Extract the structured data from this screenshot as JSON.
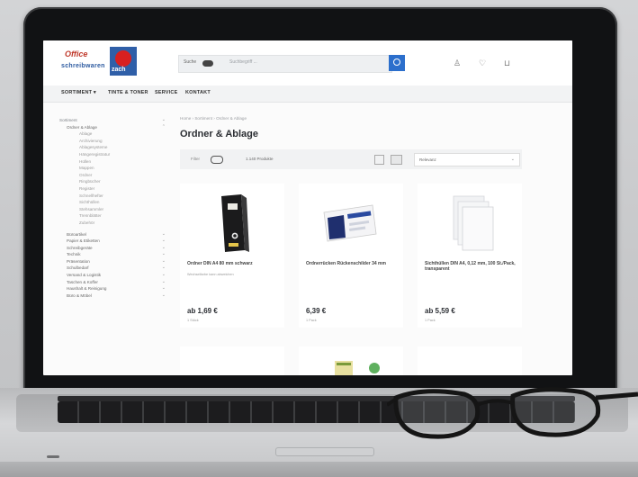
{
  "site": {
    "logo_left_line1": "Office",
    "logo_left_line2": "schreibwaren",
    "logo_brand": "zach"
  },
  "search": {
    "toggle_label": "Suche",
    "placeholder": "Suchbegriff ..."
  },
  "nav": {
    "items": [
      "SORTIMENT ▾",
      "TINTE & TONER",
      "SERVICE",
      "KONTAKT"
    ]
  },
  "sidebar": {
    "items": [
      {
        "label": "Sortiment",
        "level": 0
      },
      {
        "label": "Ordner & Ablage",
        "level": 1
      },
      {
        "label": "Ablage",
        "level": 2
      },
      {
        "label": "Archivierung",
        "level": 2
      },
      {
        "label": "Ablagesysteme",
        "level": 2
      },
      {
        "label": "Hängeregistratur",
        "level": 2
      },
      {
        "label": "Hüllen",
        "level": 2
      },
      {
        "label": "Mappen",
        "level": 2
      },
      {
        "label": "Ordner",
        "level": 2
      },
      {
        "label": "Ringbücher",
        "level": 2
      },
      {
        "label": "Register",
        "level": 2
      },
      {
        "label": "Schnellhefter",
        "level": 2
      },
      {
        "label": "Sichthüllen",
        "level": 2
      },
      {
        "label": "Stehsammler",
        "level": 2
      },
      {
        "label": "Trennblätter",
        "level": 2
      },
      {
        "label": "Zubehör",
        "level": 2
      },
      {
        "label": "Büroartikel",
        "level": 1
      },
      {
        "label": "Papier & Etiketten",
        "level": 1
      },
      {
        "label": "Schreibgeräte",
        "level": 1
      },
      {
        "label": "Technik",
        "level": 1
      },
      {
        "label": "Präsentation",
        "level": 1
      },
      {
        "label": "Schulbedarf",
        "level": 1
      },
      {
        "label": "Versand & Logistik",
        "level": 1
      },
      {
        "label": "Taschen & Koffer",
        "level": 1
      },
      {
        "label": "Haushalt & Reinigung",
        "level": 1
      },
      {
        "label": "Büro & Möbel",
        "level": 1
      }
    ]
  },
  "breadcrumb": "Home › Sortiment › Ordner & Ablage",
  "page_title": "Ordner & Ablage",
  "filter": {
    "toggle_label": "Filter",
    "count": "1.140 Produkte",
    "sort": "Relevanz"
  },
  "products": [
    {
      "name": "Ordner DIN A4 80 mm schwarz",
      "sub": "Wechselfarbe kann abweichen",
      "price": "ab 1,69 €",
      "unit": "1 Stück"
    },
    {
      "name": "Ordnerrücken Rückenschilder 34 mm",
      "sub": "",
      "price": "6,39 €",
      "unit": "1 Pack"
    },
    {
      "name": "Sichthüllen DIN A4, 0,12 mm, 100 St./Pack, transparent",
      "sub": "",
      "price": "ab 5,59 €",
      "unit": "1 Pack"
    }
  ],
  "colors": {
    "accent": "#2c6fcc",
    "brand_red": "#d82020",
    "brand_blue": "#2f5fa8"
  }
}
